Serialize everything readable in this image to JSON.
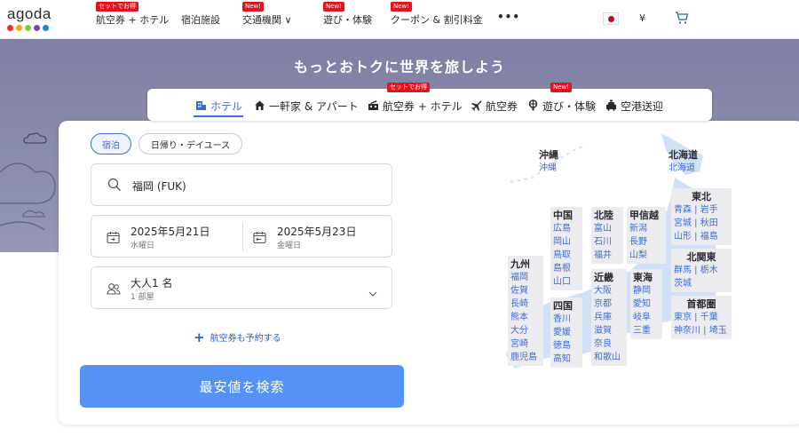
{
  "logo": {
    "text": "agoda",
    "dot_colors": [
      "#e6332a",
      "#f4a521",
      "#8ac541",
      "#7b47a8",
      "#1b86d1"
    ]
  },
  "nav": {
    "items": [
      {
        "label": "航空券 + ホテル",
        "badge": "セットでお得"
      },
      {
        "label": "宿泊施設",
        "badge": ""
      },
      {
        "label": "交通機関 ∨",
        "badge": "New!"
      },
      {
        "label": "遊び・体験",
        "badge": "New!"
      },
      {
        "label": "クーポン & 割引料金",
        "badge": "New!"
      }
    ],
    "more": "•••",
    "currency": "¥",
    "cart_icon": "cart-icon"
  },
  "hero": {
    "title": "もっとおトクに世界を旅しよう"
  },
  "tabs": {
    "items": [
      {
        "label": "ホテル",
        "icon": "hotel-icon",
        "active": true
      },
      {
        "label": "一軒家 & アパート",
        "icon": "house-icon",
        "active": false
      },
      {
        "label": "航空券 + ホテル",
        "icon": "flight-hotel-icon",
        "active": false,
        "badge": "セットでお得"
      },
      {
        "label": "航空券",
        "icon": "plane-icon",
        "active": false
      },
      {
        "label": "遊び・体験",
        "icon": "activities-icon",
        "active": false,
        "badge": "New!"
      },
      {
        "label": "空港送迎",
        "icon": "taxi-icon",
        "active": false
      }
    ]
  },
  "search": {
    "stay_type": {
      "overnight": "宿泊",
      "dayuse": "日帰り・デイユース"
    },
    "destination": "福岡 (FUK)",
    "checkin": {
      "date": "2025年5月21日",
      "day": "水曜日"
    },
    "checkout": {
      "date": "2025年5月23日",
      "day": "金曜日"
    },
    "guests": {
      "main": "大人1 名",
      "rooms": "1 部屋"
    },
    "add_flight": "航空券も予約する",
    "button": "最安値を検索"
  },
  "map": {
    "regions": [
      {
        "name": "沖縄",
        "cities": [
          "沖縄"
        ]
      },
      {
        "name": "北海道",
        "cities": [
          "北海道"
        ]
      },
      {
        "name": "東北",
        "cities": [
          "青森 | 岩手",
          "宮城 | 秋田",
          "山形 | 福島"
        ]
      },
      {
        "name": "中国",
        "cities": [
          "広島",
          "岡山",
          "鳥取",
          "島根",
          "山口"
        ]
      },
      {
        "name": "北陸",
        "cities": [
          "富山",
          "石川",
          "福井"
        ]
      },
      {
        "name": "甲信越",
        "cities": [
          "新潟",
          "長野",
          "山梨"
        ]
      },
      {
        "name": "北関東",
        "cities": [
          "群馬 | 栃木",
          "茨城"
        ]
      },
      {
        "name": "九州",
        "cities": [
          "福岡",
          "佐賀",
          "長崎",
          "熊本",
          "大分",
          "宮崎",
          "鹿児島"
        ]
      },
      {
        "name": "近畿",
        "cities": [
          "大阪",
          "京都",
          "兵庫",
          "滋賀",
          "奈良",
          "和歌山"
        ]
      },
      {
        "name": "東海",
        "cities": [
          "静岡",
          "愛知",
          "岐阜",
          "三重"
        ]
      },
      {
        "name": "四国",
        "cities": [
          "香川",
          "愛媛",
          "徳島",
          "高知"
        ]
      },
      {
        "name": "首都圏",
        "cities": [
          "東京 | 千葉",
          "神奈川 | 埼玉"
        ]
      }
    ]
  },
  "colors": {
    "accent": "#3c6cd8",
    "button": "#5492f5",
    "badge": "#e1141d",
    "hero": "#8a8bab"
  }
}
